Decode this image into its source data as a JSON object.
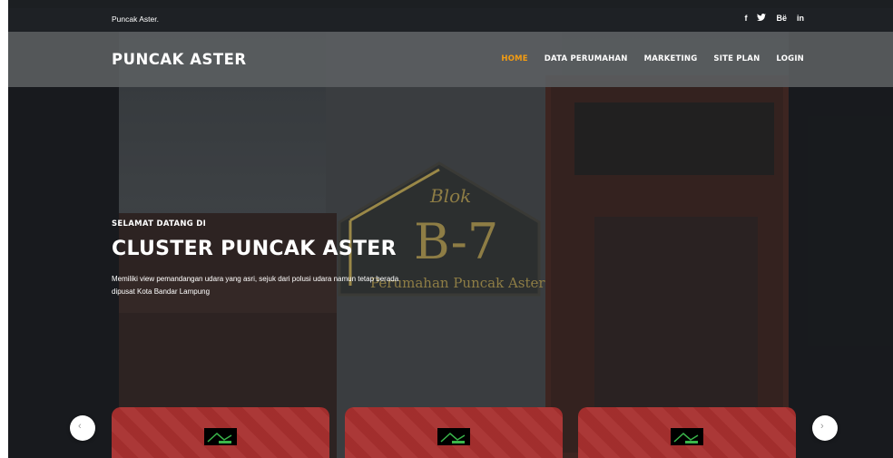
{
  "topbar": {
    "brand": "Puncak Aster.",
    "socials": [
      {
        "label": "f",
        "icon": "facebook-icon"
      },
      {
        "label": "♥",
        "icon": "twitter-icon"
      },
      {
        "label": "Bë",
        "icon": "behance-icon"
      },
      {
        "label": "in",
        "icon": "linkedin-icon"
      }
    ]
  },
  "navbar": {
    "logo": "PUNCAK ASTER",
    "menu": [
      {
        "label": "HOME",
        "active": true
      },
      {
        "label": "DATA PERUMAHAN",
        "active": false
      },
      {
        "label": "MARKETING",
        "active": false
      },
      {
        "label": "SITE PLAN",
        "active": false
      },
      {
        "label": "LOGIN",
        "active": false
      }
    ]
  },
  "hero": {
    "kicker": "SELAMAT DATANG DI",
    "title": "CLUSTER PUNCAK ASTER",
    "description": "Memiliki view pemandangan udara yang asri, sejuk dari polusi udara namun tetap berada dipusat Kota Bandar Lampung",
    "plaque": {
      "line1": "Blok",
      "line2": "B-7",
      "line3": "Perumahan Puncak Aster"
    }
  },
  "colors": {
    "accent": "#f39c12",
    "card": "#a8302f",
    "topbar": "#1e2125"
  },
  "cards": [
    {
      "icon": "house-logo-icon"
    },
    {
      "icon": "house-logo-icon"
    },
    {
      "icon": "house-logo-icon"
    }
  ]
}
